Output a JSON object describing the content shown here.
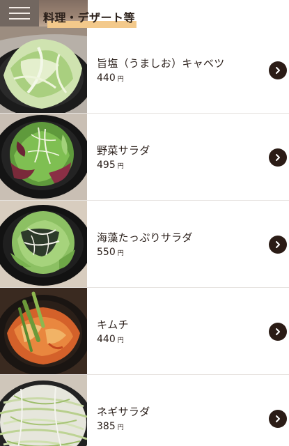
{
  "header": {
    "section_title": "料理・デザート等"
  },
  "items": [
    {
      "name": "旨塩（うましお）キャベツ",
      "price": "440",
      "unit": "円",
      "image": "cabbage"
    },
    {
      "name": "野菜サラダ",
      "price": "495",
      "unit": "円",
      "image": "vegetable-salad"
    },
    {
      "name": "海藻たっぷりサラダ",
      "price": "550",
      "unit": "円",
      "image": "seaweed-salad"
    },
    {
      "name": "キムチ",
      "price": "440",
      "unit": "円",
      "image": "kimchi"
    },
    {
      "name": "ネギサラダ",
      "price": "385",
      "unit": "円",
      "image": "green-onion-salad"
    }
  ],
  "icons": {
    "menu": "hamburger-menu-icon",
    "detail": "chevron-right-icon"
  },
  "colors": {
    "accent_highlight": "#f3c98b",
    "chevron_bg": "#2b1c16",
    "menu_bg": "#3c2d23"
  }
}
